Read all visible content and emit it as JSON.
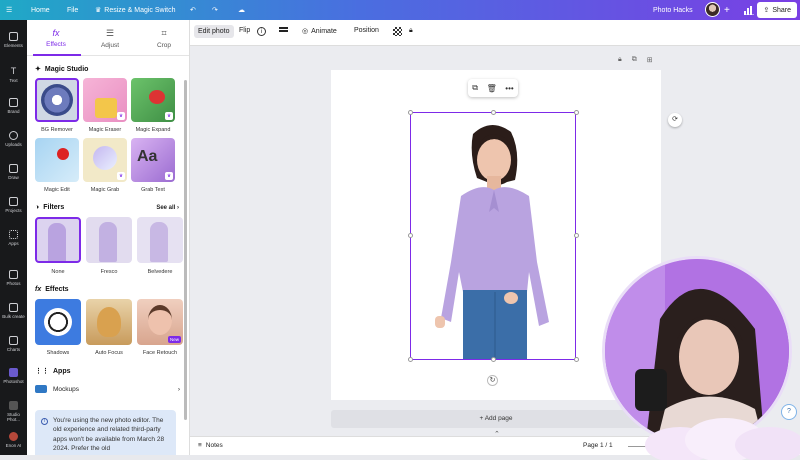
{
  "topbar": {
    "home": "Home",
    "file": "File",
    "resize": "Resize & Magic Switch",
    "project_title": "Photo Hacks",
    "share": "Share"
  },
  "left_rail": [
    {
      "label": "Elements",
      "icon": "elements-icon"
    },
    {
      "label": "Text",
      "icon": "text-icon"
    },
    {
      "label": "Brand",
      "icon": "brand-icon"
    },
    {
      "label": "Uploads",
      "icon": "uploads-icon"
    },
    {
      "label": "Draw",
      "icon": "draw-icon"
    },
    {
      "label": "Projects",
      "icon": "projects-icon"
    },
    {
      "label": "Apps",
      "icon": "apps-icon"
    },
    {
      "label": "Photos",
      "icon": "photos-icon"
    },
    {
      "label": "Bulk create",
      "icon": "bulk-create-icon"
    },
    {
      "label": "Charts",
      "icon": "charts-icon"
    },
    {
      "label": "Photoshot",
      "icon": "photoshot-icon"
    },
    {
      "label": "Studio Phot...",
      "icon": "studio-photo-icon"
    },
    {
      "label": "Enon AI",
      "icon": "enon-ai-icon"
    }
  ],
  "panel": {
    "tabs": [
      {
        "label": "Effects",
        "icon": "fx"
      },
      {
        "label": "Adjust",
        "icon": "≡"
      },
      {
        "label": "Crop",
        "icon": "⌗"
      }
    ],
    "magic_studio": {
      "title": "Magic Studio",
      "items": [
        "BG Remover",
        "Magic Eraser",
        "Magic Expand",
        "Magic Edit",
        "Magic Grab",
        "Grab Text"
      ]
    },
    "filters": {
      "title": "Filters",
      "see_all": "See all",
      "items": [
        "None",
        "Fresco",
        "Belvedere"
      ]
    },
    "effects": {
      "title": "Effects",
      "items": [
        "Shadows",
        "Auto Focus",
        "Face Retouch"
      ],
      "new_badge": "New"
    },
    "apps": {
      "title": "Apps",
      "mockups": "Mockups"
    },
    "notice": "You're using the new photo editor. The old experience and related third-party apps won't be available from March 28 2024. Prefer the old"
  },
  "toolbar": {
    "edit_photo": "Edit photo",
    "flip": "Flip",
    "animate": "Animate",
    "position": "Position"
  },
  "canvas": {
    "add_page": "+ Add page"
  },
  "bottombar": {
    "notes": "Notes",
    "page": "Page 1 / 1"
  },
  "colors": {
    "accent": "#7d2ae8",
    "shirt": "#b9a3e0",
    "jeans": "#3b6ea8"
  }
}
